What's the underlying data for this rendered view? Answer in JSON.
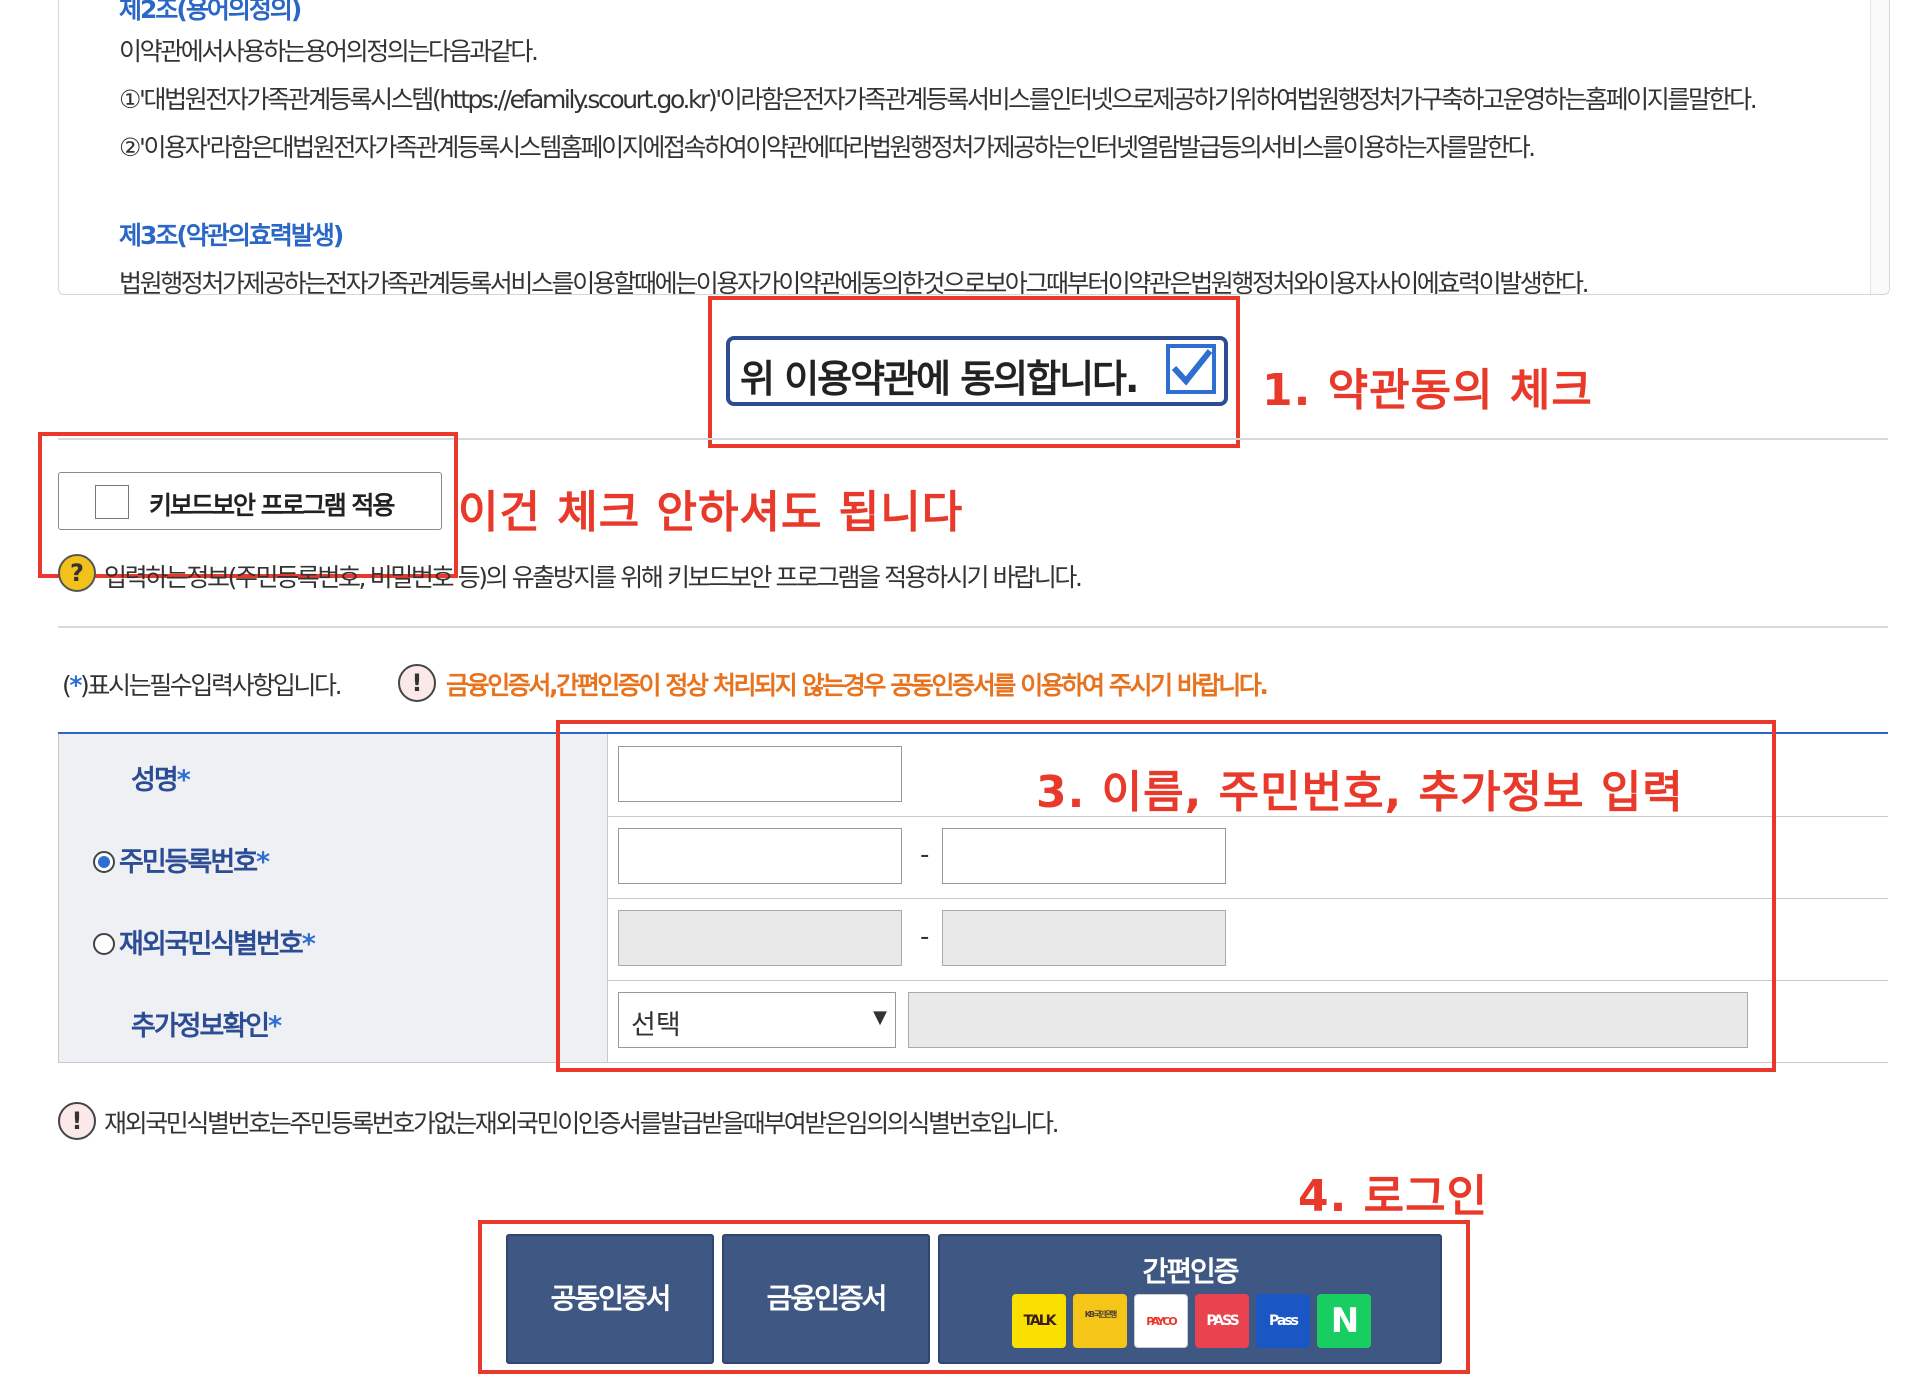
{
  "terms": {
    "article2_heading": "제2조(용어의정의)",
    "article2_intro": "이약관에서사용하는용어의정의는다음과같다.",
    "article2_item1": "①'대법원전자가족관계등록시스템(https://efamily.scourt.go.kr)'이라함은전자가족관계등록서비스를인터넷으로제공하기위하여법원행정처가구축하고운영하는홈페이지를말한다.",
    "article2_item2": "②'이용자'라함은대법원전자가족관계등록시스템홈페이지에접속하여이약관에따라법원행정처가제공하는인터넷열람발급등의서비스를이용하는자를말한다.",
    "article3_heading": "제3조(약관의효력발생)",
    "article3_text": "법원행정처가제공하는전자가족관계등록서비스를이용할때에는이용자가이약관에동의한것으로보아그때부터이약관은법원행정처와이용자사이에효력이발생한다."
  },
  "agree": {
    "label": "위 이용약관에 동의합니다.",
    "checked": true
  },
  "keyboard_security": {
    "label": "키보드보안 프로그램 적용",
    "checked": false,
    "notice": "입력하는정보(주민등록번호, 비밀번호 등)의 유출방지를 위해 키보드보안 프로그램을 적용하시기 바랍니다."
  },
  "required_note": {
    "prefix": "(",
    "star": "*",
    "suffix": ")표시는필수입력사항입니다.",
    "warning": "금융인증서,간편인증이 정상 처리되지 않는경우 공동인증서를 이용하여 주시기 바랍니다."
  },
  "form": {
    "name_label": "성명",
    "rrn_label": "주민등록번호",
    "foreigner_label": "재외국민식별번호",
    "extra_label": "추가정보확인",
    "required_mark": "*",
    "rrn_dash": "-",
    "foreigner_dash": "-",
    "extra_select": "선택",
    "id_type_selected": "주민등록번호"
  },
  "foreign_note": "재외국민식별번호는주민등록번호가없는재외국민이인증서를발급받을때부여받은임의의식별번호입니다.",
  "buttons": {
    "joint_cert": "공동인증서",
    "financial_cert": "금융인증서",
    "simple_auth": "간편인증",
    "simple_icons": [
      {
        "name": "kakao-talk-icon",
        "text": "TALK",
        "bg": "#f9e000",
        "fg": "#3a1d1d"
      },
      {
        "name": "kb-bank-icon",
        "text": "KB 국민은행",
        "bg": "#f5c518",
        "fg": "#4a3f35"
      },
      {
        "name": "payco-icon",
        "text": "PAYCO",
        "bg": "#ffffff",
        "fg": "#e8392a"
      },
      {
        "name": "pass-icon",
        "text": "PASS",
        "bg": "#e8434f",
        "fg": "#ffffff"
      },
      {
        "name": "samsung-pass-icon",
        "text": "Pass",
        "bg": "#1a56c4",
        "fg": "#ffffff"
      },
      {
        "name": "naver-icon",
        "text": "N",
        "bg": "#19ce60",
        "fg": "#ffffff"
      }
    ]
  },
  "annotations": {
    "step1": "1. 약관동의 체크",
    "keyboard_skip": "이건 체크 안하셔도 됩니다",
    "step3": "3. 이름, 주민번호, 추가정보 입력",
    "step4": "4. 로그인"
  },
  "colors": {
    "annotation_red": "#e8392a",
    "heading_blue": "#2b67c6",
    "navy_button": "#3f5783",
    "warning_orange": "#e8731f"
  }
}
